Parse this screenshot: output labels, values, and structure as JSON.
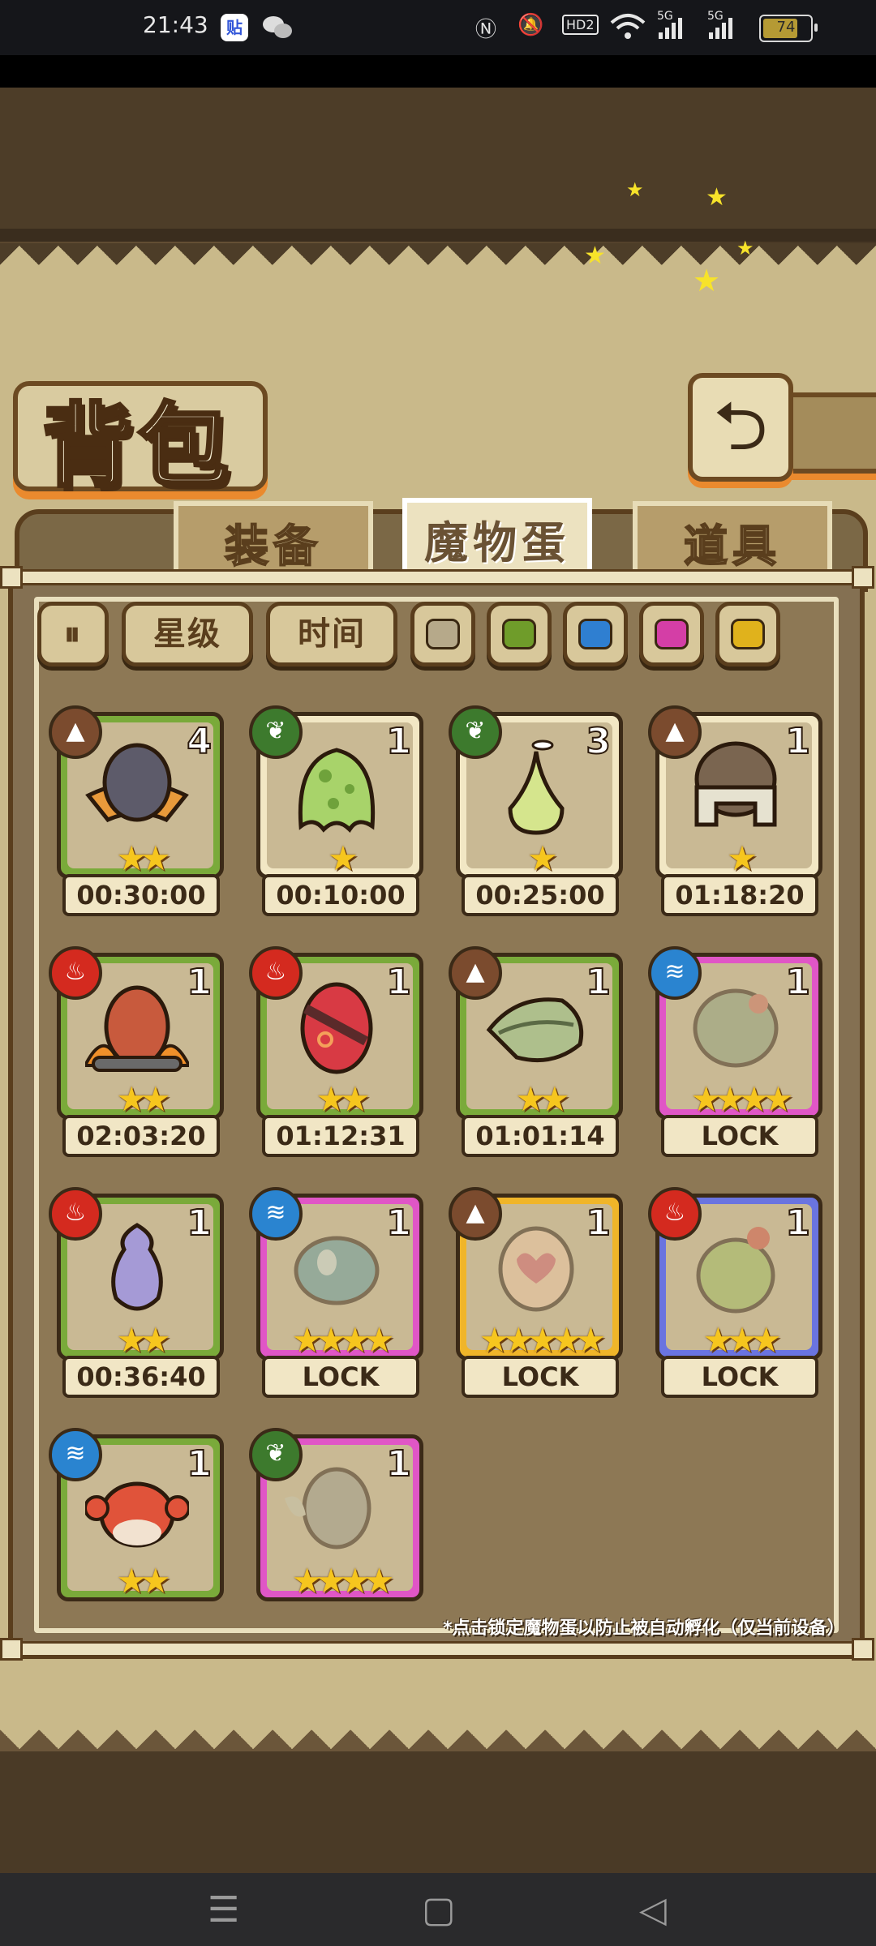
{
  "status_bar": {
    "time": "21:43",
    "app_icon_1": "贴",
    "battery": "74",
    "signal_1": "5G",
    "signal_2": "5G",
    "hd": "HD2"
  },
  "header": {
    "title": "背包",
    "back_icon": "return-arrow-icon"
  },
  "tabs": [
    {
      "label": "装备",
      "active": false
    },
    {
      "label": "魔物蛋",
      "active": true
    },
    {
      "label": "道具",
      "active": false
    }
  ],
  "filters": {
    "sort_icon": "pause-sort-icon",
    "star_label": "星级",
    "time_label": "时间",
    "colors": [
      "#b6a98a",
      "#6f9c2a",
      "#2f7fd1",
      "#d43ea6",
      "#e0b21c"
    ]
  },
  "eggs": [
    {
      "element": "earth",
      "count": "4",
      "stars": "★★",
      "timer": "00:30:00",
      "frame": "green",
      "locked": false
    },
    {
      "element": "grass",
      "count": "1",
      "stars": "★",
      "timer": "00:10:00",
      "frame": "cream",
      "locked": false
    },
    {
      "element": "grass",
      "count": "3",
      "stars": "★",
      "timer": "00:25:00",
      "frame": "cream",
      "locked": false
    },
    {
      "element": "earth",
      "count": "1",
      "stars": "★",
      "timer": "01:18:20",
      "frame": "cream",
      "locked": false
    },
    {
      "element": "fire",
      "count": "1",
      "stars": "★★",
      "timer": "02:03:20",
      "frame": "green",
      "locked": false
    },
    {
      "element": "fire",
      "count": "1",
      "stars": "★★",
      "timer": "01:12:31",
      "frame": "green",
      "locked": false
    },
    {
      "element": "earth",
      "count": "1",
      "stars": "★★",
      "timer": "01:01:14",
      "frame": "green",
      "locked": false
    },
    {
      "element": "water",
      "count": "1",
      "stars": "★★★★",
      "timer": "LOCK",
      "frame": "pink",
      "locked": true
    },
    {
      "element": "fire",
      "count": "1",
      "stars": "★★",
      "timer": "00:36:40",
      "frame": "green",
      "locked": false
    },
    {
      "element": "water",
      "count": "1",
      "stars": "★★★★",
      "timer": "LOCK",
      "frame": "pink",
      "locked": true
    },
    {
      "element": "earth",
      "count": "1",
      "stars": "★★★★★",
      "timer": "LOCK",
      "frame": "gold",
      "locked": true
    },
    {
      "element": "fire",
      "count": "1",
      "stars": "★★★",
      "timer": "LOCK",
      "frame": "blue",
      "locked": true
    },
    {
      "element": "water",
      "count": "1",
      "stars": "★★",
      "timer": "",
      "frame": "green",
      "locked": false
    },
    {
      "element": "grass",
      "count": "1",
      "stars": "★★★★",
      "timer": "",
      "frame": "pink",
      "locked": true
    }
  ],
  "hint": "*点击锁定魔物蛋以防止被自动孵化（仅当前设备）"
}
